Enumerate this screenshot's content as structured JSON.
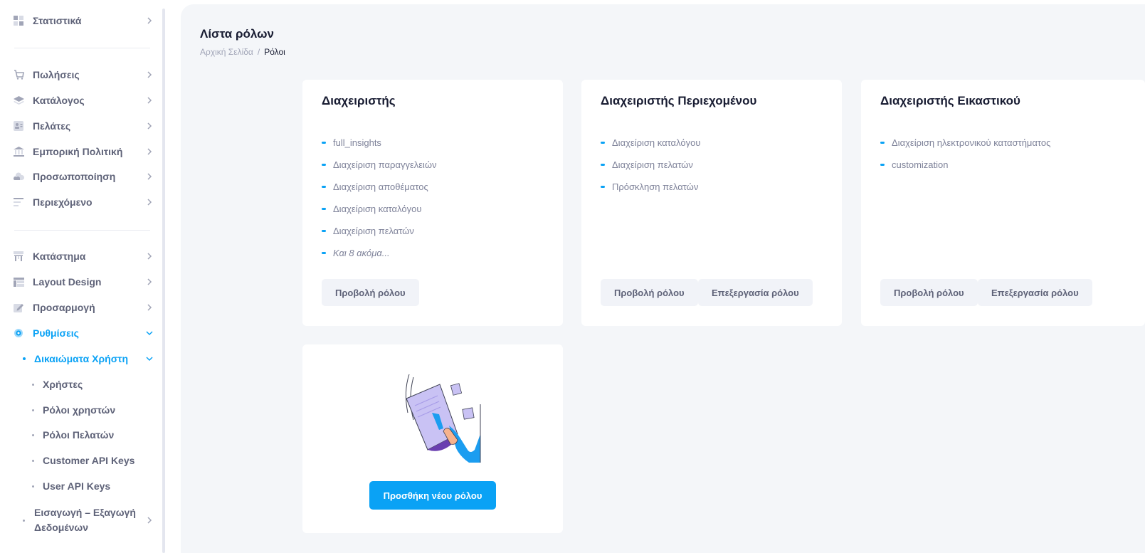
{
  "sidebar": {
    "items": [
      {
        "label": "Στατιστικά",
        "icon": "dashboard-icon"
      },
      {
        "label": "Πωλήσεις",
        "icon": "cart-icon"
      },
      {
        "label": "Κατάλογος",
        "icon": "layers-icon"
      },
      {
        "label": "Πελάτες",
        "icon": "contact-card-icon"
      },
      {
        "label": "Εμπορική Πολιτική",
        "icon": "bank-icon"
      },
      {
        "label": "Προσωποποίηση",
        "icon": "cloud-icon"
      },
      {
        "label": "Περιεχόμενο",
        "icon": "text-lines-icon"
      },
      {
        "label": "Κατάστημα",
        "icon": "store-icon"
      },
      {
        "label": "Layout Design",
        "icon": "layout-icon"
      },
      {
        "label": "Προσαρμογή",
        "icon": "edit-icon"
      },
      {
        "label": "Ρυθμίσεις",
        "icon": "gear-icon"
      }
    ],
    "settings_sub": {
      "label": "Δικαιώματα Χρήστη",
      "children": [
        "Χρήστες",
        "Ρόλοι χρηστών",
        "Ρόλοι Πελατών",
        "Customer API Keys",
        "User API Keys"
      ]
    },
    "import_export": {
      "line1": "Εισαγωγή – Εξαγωγή",
      "line2": "Δεδομένων"
    }
  },
  "header": {
    "title": "Λίστα ρόλων",
    "breadcrumb_home": "Αρχική Σελίδα",
    "breadcrumb_sep": "/",
    "breadcrumb_current": "Ρόλοι"
  },
  "roles": [
    {
      "title": "Διαχειριστής",
      "permissions": [
        "full_insights",
        "Διαχείριση παραγγελειών",
        "Διαχείριση αποθέματος",
        "Διαχείριση καταλόγου",
        "Διαχείριση πελατών"
      ],
      "more": "Και 8 ακόμα...",
      "view_label": "Προβολή ρόλου"
    },
    {
      "title": "Διαχειριστής Περιεχομένου",
      "permissions": [
        "Διαχείριση καταλόγου",
        "Διαχείριση πελατών",
        "Πρόσκληση πελατών"
      ],
      "view_label": "Προβολή ρόλου",
      "edit_label": "Επεξεργασία ρόλου"
    },
    {
      "title": "Διαχειριστής Εικαστικού",
      "permissions": [
        "Διαχείριση ηλεκτρονικού καταστήματος",
        "customization"
      ],
      "view_label": "Προβολή ρόλου",
      "edit_label": "Επεξεργασία ρόλου"
    }
  ],
  "add_role": {
    "label": "Προσθήκη νέου ρόλου",
    "illustration": "document-hand-illustration"
  },
  "colors": {
    "accent": "#0aa2f5",
    "background": "#f4f6f9",
    "title": "#181c32",
    "muted": "#7e8299"
  }
}
